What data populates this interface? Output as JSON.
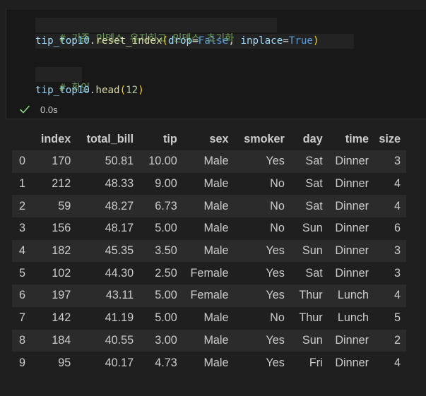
{
  "code_cell": {
    "line1_comment": "# 기존 인덱스 유지하고 인덱스 초기화",
    "line2": {
      "var": "tip_top10",
      "method": "reset_index",
      "open": "(",
      "arg1_name": "drop",
      "arg1_value": "False",
      "sep": ", ",
      "arg2_name": "inplace",
      "arg2_value": "True",
      "close": ")"
    },
    "line4_comment": "# 확인",
    "line5": {
      "var": "tip_top10",
      "method": "head",
      "open": "(",
      "arg": "12",
      "close": ")"
    }
  },
  "status": {
    "icon": "check-icon",
    "exec_time": "0.0s",
    "success_color": "#89d185"
  },
  "output_table": {
    "columns": [
      "index",
      "total_bill",
      "tip",
      "sex",
      "smoker",
      "day",
      "time",
      "size"
    ],
    "rows": [
      {
        "idx": "0",
        "cells": [
          "170",
          "50.81",
          "10.00",
          "Male",
          "Yes",
          "Sat",
          "Dinner",
          "3"
        ]
      },
      {
        "idx": "1",
        "cells": [
          "212",
          "48.33",
          "9.00",
          "Male",
          "No",
          "Sat",
          "Dinner",
          "4"
        ]
      },
      {
        "idx": "2",
        "cells": [
          "59",
          "48.27",
          "6.73",
          "Male",
          "No",
          "Sat",
          "Dinner",
          "4"
        ]
      },
      {
        "idx": "3",
        "cells": [
          "156",
          "48.17",
          "5.00",
          "Male",
          "No",
          "Sun",
          "Dinner",
          "6"
        ]
      },
      {
        "idx": "4",
        "cells": [
          "182",
          "45.35",
          "3.50",
          "Male",
          "Yes",
          "Sun",
          "Dinner",
          "3"
        ]
      },
      {
        "idx": "5",
        "cells": [
          "102",
          "44.30",
          "2.50",
          "Female",
          "Yes",
          "Sat",
          "Dinner",
          "3"
        ]
      },
      {
        "idx": "6",
        "cells": [
          "197",
          "43.11",
          "5.00",
          "Female",
          "Yes",
          "Thur",
          "Lunch",
          "4"
        ]
      },
      {
        "idx": "7",
        "cells": [
          "142",
          "41.19",
          "5.00",
          "Male",
          "No",
          "Thur",
          "Lunch",
          "5"
        ]
      },
      {
        "idx": "8",
        "cells": [
          "184",
          "40.55",
          "3.00",
          "Male",
          "Yes",
          "Sun",
          "Dinner",
          "2"
        ]
      },
      {
        "idx": "9",
        "cells": [
          "95",
          "40.17",
          "4.73",
          "Male",
          "Yes",
          "Fri",
          "Dinner",
          "4"
        ]
      }
    ]
  }
}
